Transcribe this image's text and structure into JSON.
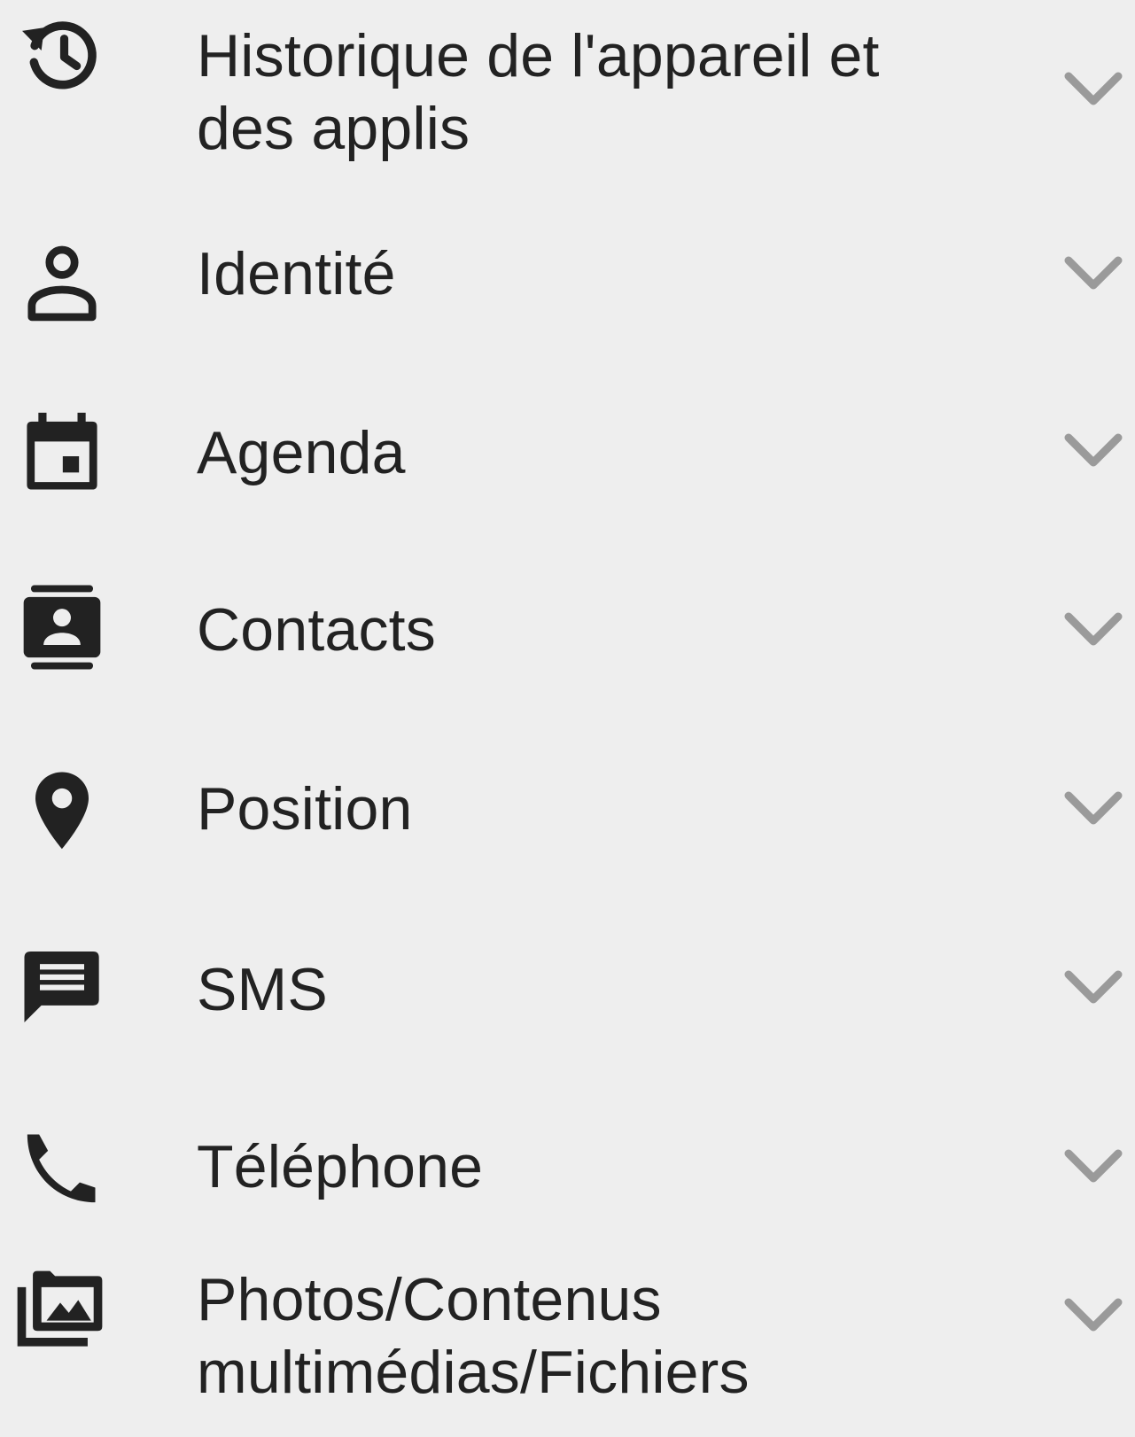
{
  "permissions": [
    {
      "label_line1": "Historique de l'appareil et",
      "label_line2": "des applis",
      "icon": "history-icon"
    },
    {
      "label": "Identité",
      "icon": "person-icon"
    },
    {
      "label": "Agenda",
      "icon": "calendar-icon"
    },
    {
      "label": "Contacts",
      "icon": "contacts-icon"
    },
    {
      "label": "Position",
      "icon": "location-pin-icon"
    },
    {
      "label": "SMS",
      "icon": "message-icon"
    },
    {
      "label": "Téléphone",
      "icon": "phone-icon"
    },
    {
      "label_line1": "Photos/Contenus",
      "label_line2": "multimédias/Fichiers",
      "icon": "photo-library-icon"
    }
  ],
  "colors": {
    "background": "#eeeeee",
    "icon": "#222222",
    "text": "#222222",
    "chevron": "#9a9a9a"
  }
}
